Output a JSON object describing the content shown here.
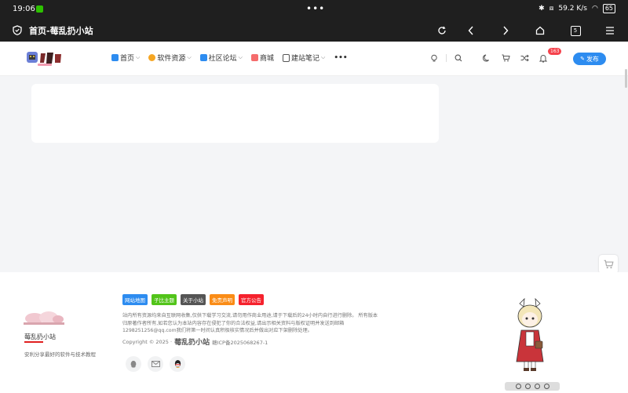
{
  "statusbar": {
    "time": "19:06",
    "network": "59.2 K/s",
    "battery": "65"
  },
  "browser": {
    "title": "首页-莓乱扔小站",
    "tab_count": "5"
  },
  "nav": {
    "items": [
      {
        "label": "首页",
        "color": "#2d8cf0"
      },
      {
        "label": "软件资源",
        "color": "#f5a623"
      },
      {
        "label": "社区论坛",
        "color": "#2d8cf0"
      },
      {
        "label": "商城",
        "color": "#f56c6c"
      },
      {
        "label": "建站笔记",
        "color": "#555555"
      }
    ],
    "more": "•••",
    "notification_count": "163",
    "publish_label": "发布"
  },
  "footer": {
    "site_name": "莓乱扔小站",
    "site_desc": "安利分享最好的软件与技术教程",
    "tags": [
      {
        "label": "网站地图",
        "color": "#2d8cf0"
      },
      {
        "label": "子比主题",
        "color": "#52c41a"
      },
      {
        "label": "关于小站",
        "color": "#555555"
      },
      {
        "label": "免责声明",
        "color": "#fa8c16"
      },
      {
        "label": "官方公告",
        "color": "#f5222d"
      }
    ],
    "disclaimer": "站内所有资源均来自互联网收集,仅供下载学习交流,请勿用作商业用途,请于下载后的24小时内自行进行删除。 所有版本归原著作者所有,如若您认为本站内容存在侵犯了你的合法权益,请出示相关资料与版权证明并发送到邮箱1298251256@qq.com我们将第一时间认真积极核实情况后并做出对应下架删除处理。",
    "copyright_prefix": "Copyright © 2025 ·",
    "copyright_brand": "莓乱扔小站",
    "icp": "赣ICP备2025068267-1"
  }
}
